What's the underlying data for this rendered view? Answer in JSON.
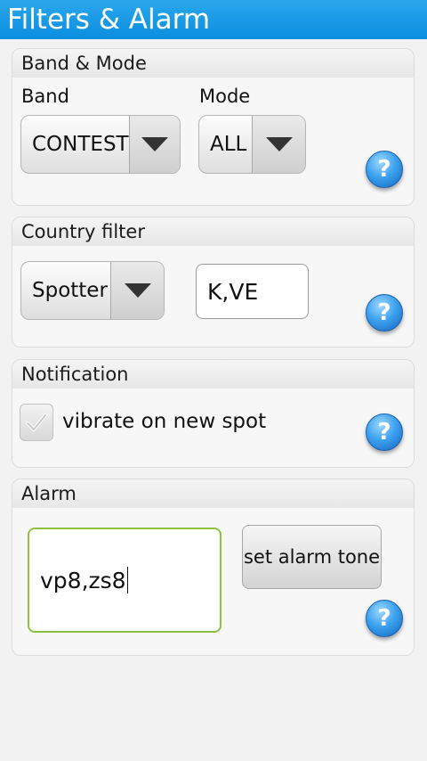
{
  "app": {
    "title": "Filters & Alarm"
  },
  "band_mode": {
    "header": "Band & Mode",
    "band_label": "Band",
    "band_value": "CONTEST",
    "mode_label": "Mode",
    "mode_value": "ALL",
    "help": "?"
  },
  "country_filter": {
    "header": "Country filter",
    "spotter_value": "Spotter",
    "country_value": "K,VE",
    "help": "?"
  },
  "notification": {
    "header": "Notification",
    "vibrate_label": "vibrate on new spot",
    "vibrate_checked": true,
    "help": "?"
  },
  "alarm": {
    "header": "Alarm",
    "alarm_value": "vp8,zs8",
    "set_tone_label": "set alarm tone",
    "help": "?"
  },
  "colors": {
    "titlebar": "#0b8ee0",
    "focus_border": "#8dc040",
    "help_icon": "#3ea2f0"
  }
}
